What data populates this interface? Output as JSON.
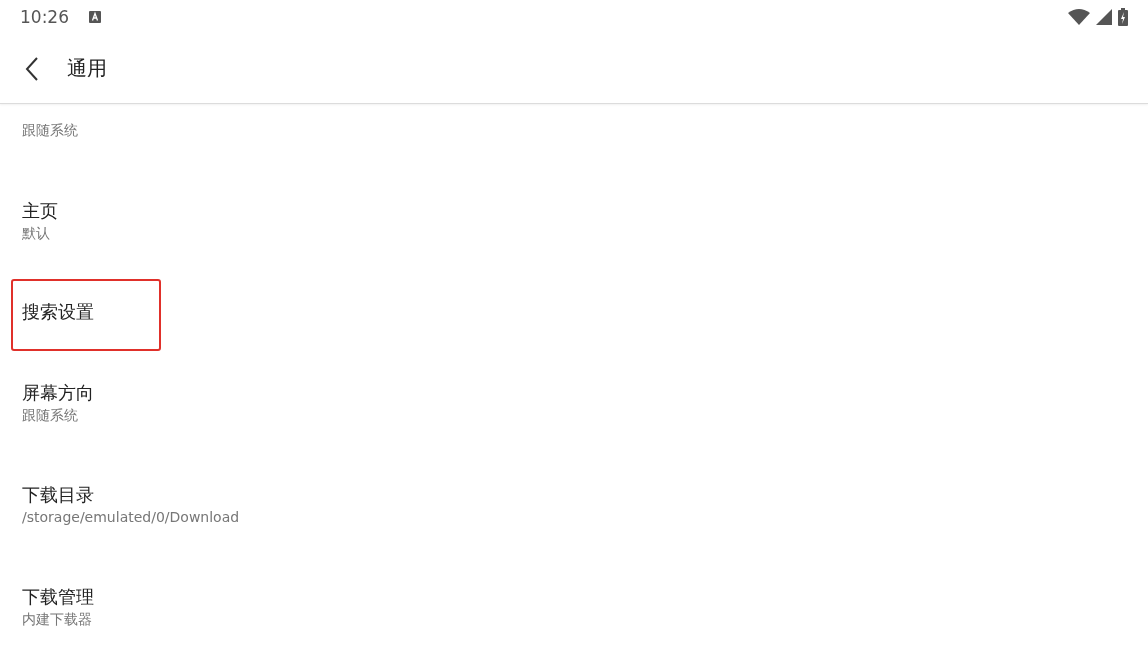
{
  "status_bar": {
    "time": "10:26"
  },
  "toolbar": {
    "title": "通用"
  },
  "items": [
    {
      "subtitle": "跟随系统",
      "highlighted": false
    },
    {
      "title": "主页",
      "subtitle": "默认",
      "highlighted": false
    },
    {
      "title": "搜索设置",
      "highlighted": true
    },
    {
      "title": "屏幕方向",
      "subtitle": "跟随系统",
      "highlighted": false
    },
    {
      "title": "下载目录",
      "subtitle": "/storage/emulated/0/Download",
      "highlighted": false
    },
    {
      "title": "下载管理",
      "subtitle": "内建下载器",
      "highlighted": false
    }
  ]
}
